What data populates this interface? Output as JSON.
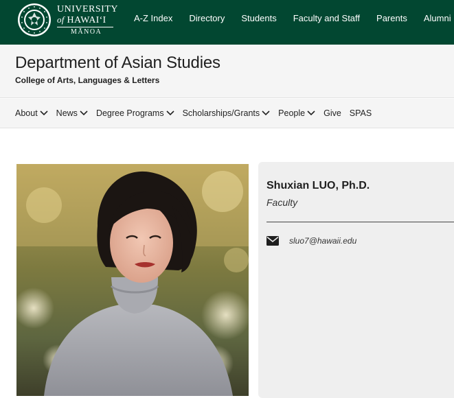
{
  "header": {
    "logo": {
      "line1": "UNIVERSITY",
      "line2_of": "of",
      "line2_name": "HAWAI‘I",
      "line3": "MĀNOA"
    },
    "nav": [
      "A-Z Index",
      "Directory",
      "Students",
      "Faculty and Staff",
      "Parents",
      "Alumni"
    ]
  },
  "department": {
    "title": "Department of Asian Studies",
    "college": "College of Arts, Languages & Letters"
  },
  "subnav": [
    {
      "label": "About",
      "dropdown": true
    },
    {
      "label": "News",
      "dropdown": true
    },
    {
      "label": "Degree Programs",
      "dropdown": true
    },
    {
      "label": "Scholarships/Grants",
      "dropdown": true
    },
    {
      "label": "People",
      "dropdown": true
    },
    {
      "label": "Give",
      "dropdown": false
    },
    {
      "label": "SPAS",
      "dropdown": false
    }
  ],
  "profile": {
    "name": "Shuxian LUO, Ph.D.",
    "role": "Faculty",
    "email": "sluo7@hawaii.edu"
  },
  "colors": {
    "brand_green": "#024731",
    "header_bg": "#f5f5f5",
    "card_bg": "#efefef"
  },
  "icons": [
    "university-seal-icon",
    "chevron-down-icon",
    "envelope-icon"
  ]
}
